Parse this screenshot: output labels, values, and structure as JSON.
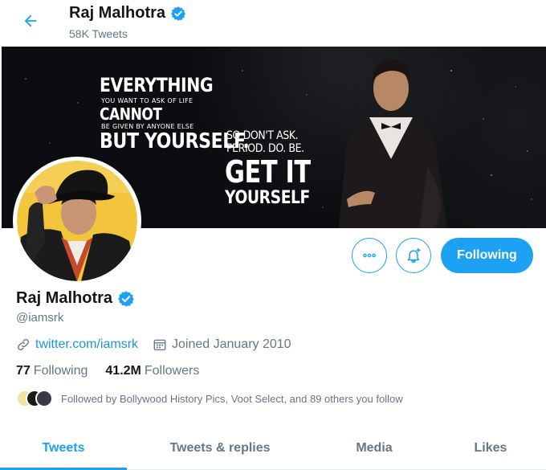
{
  "header": {
    "name": "Raj Malhotra",
    "tweet_count": "58K Tweets",
    "back_icon": "arrow-left-icon",
    "verified_icon": "verified-badge-icon"
  },
  "banner": {
    "quote": {
      "line1": "EVERYTHING",
      "line2": "YOU WANT TO ASK OF LIFE",
      "line3": "CANNOT",
      "line4": "BE GIVEN BY ANYONE ELSE",
      "line5": "BUT YOURSELF.",
      "line6": "SO DON'T ASK.",
      "line7": "PERIOD. DO. BE.",
      "line8": "GET IT",
      "line9": "YOURSELF"
    }
  },
  "actions": {
    "more_icon": "more-icon",
    "notify_icon": "bell-plus-icon",
    "following_label": "Following"
  },
  "profile": {
    "name": "Raj Malhotra",
    "handle": "@iamsrk",
    "link_icon": "link-icon",
    "website": "twitter.com/iamsrk",
    "calendar_icon": "calendar-icon",
    "joined": "Joined January 2010",
    "following_count": "77",
    "following_label": "Following",
    "followers_count": "41.2M",
    "followers_label": "Followers",
    "followed_by": "Followed by Bollywood History Pics, Voot Select, and 89 others you follow"
  },
  "tabs": [
    {
      "label": "Tweets",
      "active": true
    },
    {
      "label": "Tweets & replies",
      "active": false
    },
    {
      "label": "Media",
      "active": false
    },
    {
      "label": "Likes",
      "active": false
    }
  ],
  "colors": {
    "accent": "#1da1f2",
    "link": "#1b95e0",
    "muted": "#657786",
    "banner_bg": "#0c0d10"
  }
}
